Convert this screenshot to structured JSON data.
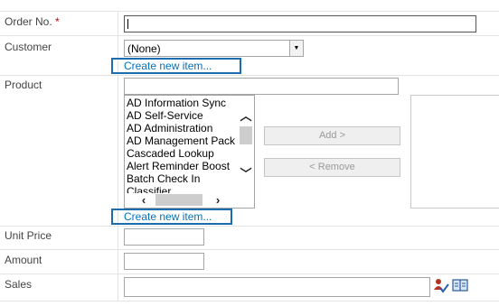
{
  "fields": {
    "order_no": {
      "label": "Order No.",
      "required_mark": "*",
      "value": ""
    },
    "customer": {
      "label": "Customer",
      "selected": "(None)",
      "create_link": "Create new item..."
    },
    "product": {
      "label": "Product",
      "filter_value": "",
      "options": [
        "AD Information Sync",
        "AD Self-Service",
        "AD Administration",
        "AD Management Pack",
        "Cascaded Lookup",
        "Alert Reminder Boost",
        "Batch Check In",
        "Classifier"
      ],
      "add_button": "Add >",
      "remove_button": "< Remove",
      "create_link": "Create new item..."
    },
    "unit_price": {
      "label": "Unit Price",
      "value": ""
    },
    "amount": {
      "label": "Amount",
      "value": ""
    },
    "sales": {
      "label": "Sales",
      "value": ""
    }
  },
  "icons": {
    "check_names": "check-names-icon",
    "browse": "address-book-icon"
  }
}
